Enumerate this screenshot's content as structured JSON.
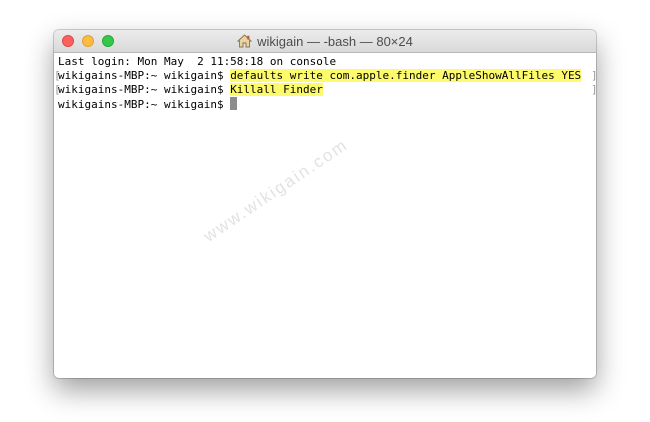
{
  "window": {
    "title": "wikigain — -bash — 80×24",
    "title_icon": "home-icon",
    "traffic_lights": {
      "close_color": "#fc615d",
      "minimize_color": "#fdbc40",
      "zoom_color": "#34c84a"
    }
  },
  "terminal": {
    "last_login": "Last login: Mon May  2 11:58:18 on console",
    "lines": [
      {
        "prompt": "wikigains-MBP:~ wikigain$ ",
        "command": "defaults write com.apple.finder AppleShowAllFiles YES"
      },
      {
        "prompt": "wikigains-MBP:~ wikigain$ ",
        "command": "Killall Finder"
      },
      {
        "prompt": "wikigains-MBP:~ wikigain$ ",
        "command": ""
      }
    ],
    "highlight_color": "#fdfa6b",
    "bracket_left": "[",
    "bracket_right": "]"
  },
  "watermark": "www.wikigain.com"
}
